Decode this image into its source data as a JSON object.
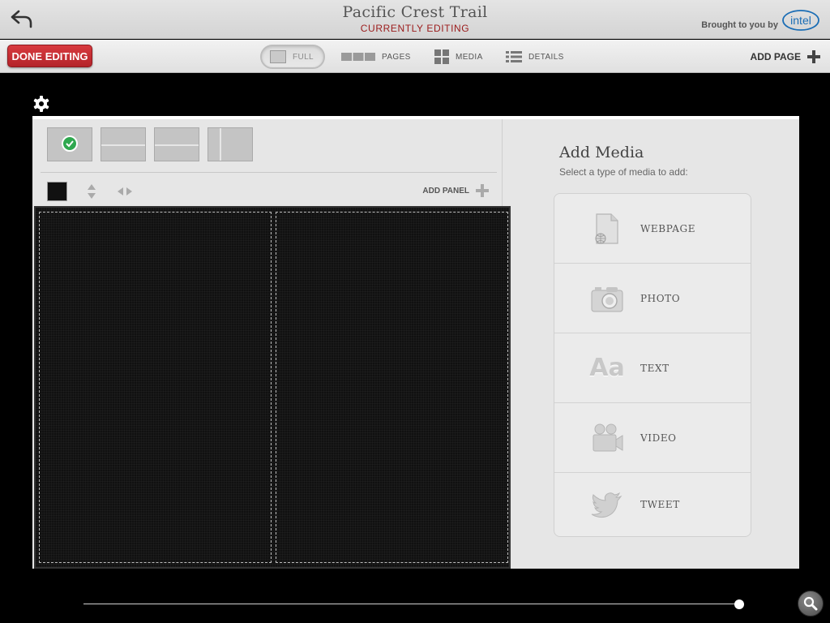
{
  "header": {
    "title": "Pacific Crest Trail",
    "subtitle": "CURRENTLY EDITING",
    "brought_by": "Brought to you by",
    "brand_logo": "intel"
  },
  "toolbar": {
    "done_label": "DONE EDITING",
    "tabs": [
      {
        "label": "FULL",
        "icon": "full-view-icon",
        "active": true
      },
      {
        "label": "PAGES",
        "icon": "pages-view-icon",
        "active": false
      },
      {
        "label": "MEDIA",
        "icon": "media-grid-icon",
        "active": false
      },
      {
        "label": "DETAILS",
        "icon": "details-list-icon",
        "active": false
      }
    ],
    "add_page_label": "ADD PAGE"
  },
  "editor": {
    "layouts": [
      {
        "icon": "single-panel-layout-icon",
        "selected": true
      },
      {
        "icon": "two-row-layout-icon",
        "selected": false
      },
      {
        "icon": "two-row-layout-icon",
        "selected": false
      },
      {
        "icon": "two-column-layout-icon",
        "selected": false
      }
    ],
    "add_panel_label": "ADD PANEL",
    "background_color": "#111111"
  },
  "media": {
    "title": "Add Media",
    "subtitle": "Select a type of media to add:",
    "items": [
      {
        "label": "WEBPAGE",
        "icon": "webpage-icon"
      },
      {
        "label": "PHOTO",
        "icon": "camera-icon"
      },
      {
        "label": "TEXT",
        "icon": "text-icon",
        "glyph": "Aa"
      },
      {
        "label": "VIDEO",
        "icon": "video-camera-icon"
      },
      {
        "label": "TWEET",
        "icon": "twitter-bird-icon"
      }
    ]
  },
  "colors": {
    "accent_red": "#c0282e",
    "subtitle_red": "#9b1b1b",
    "check_green": "#2fa84f"
  }
}
